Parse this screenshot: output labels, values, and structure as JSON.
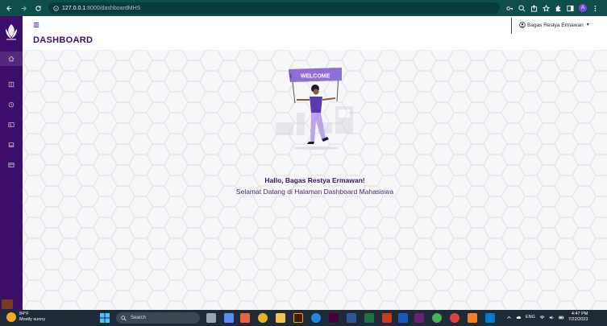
{
  "browser": {
    "url_host": "127.0.0.1",
    "url_path": ":8000/dashboardMHS",
    "profile_initial": "A"
  },
  "sidebar": {
    "items": [
      {
        "icon": "home-icon"
      },
      {
        "icon": "book-icon"
      },
      {
        "icon": "clock-icon"
      },
      {
        "icon": "id-card-icon"
      },
      {
        "icon": "inbox-icon"
      },
      {
        "icon": "card-icon"
      }
    ]
  },
  "header": {
    "title": "DASHBOARD",
    "user_name": "Bagas Restya Ermawan"
  },
  "hero": {
    "banner_text": "WELCOME",
    "greeting": "Hallo, Bagas Restya Ermawan!",
    "subtitle": "Selamat Datang di Halaman Dashboard Mahasiswa"
  },
  "taskbar": {
    "weather_temp": "84°F",
    "weather_desc": "Mostly sunny",
    "search_placeholder": "Search",
    "lang": "ENG",
    "time": "4:47 PM",
    "date": "7/22/2023"
  },
  "colors": {
    "primary": "#3c0d6b",
    "browser_bar": "#0f4f4b",
    "accent": "#8e6fd8"
  }
}
